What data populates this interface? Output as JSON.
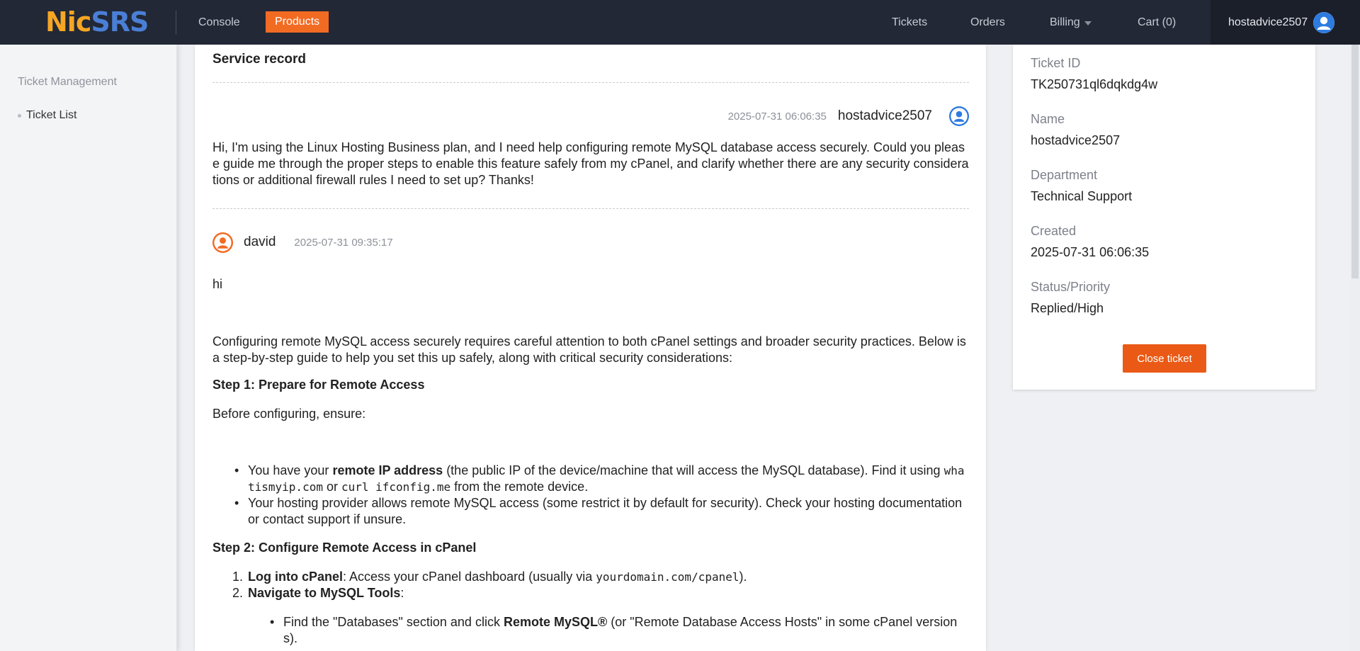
{
  "header": {
    "logo_nic": "Nic",
    "logo_srs": "SRS",
    "nav": {
      "console": "Console",
      "products": "Products",
      "tickets": "Tickets",
      "orders": "Orders",
      "billing": "Billing",
      "cart": "Cart (0)",
      "user": "hostadvice2507"
    }
  },
  "sidebar": {
    "title": "Ticket Management",
    "items": [
      {
        "label": "Ticket List"
      }
    ]
  },
  "main": {
    "section_title": "Service record",
    "messages": [
      {
        "author": "hostadvice2507",
        "time": "2025-07-31 06:06:35",
        "body": "Hi, I'm using the Linux Hosting Business plan, and I need help configuring remote MySQL database access securely. Could you please guide me through the proper steps to enable this feature safely from my cPanel, and clarify whether there are any security considerations or additional firewall rules I need to set up? Thanks!"
      },
      {
        "author": "david",
        "time": "2025-07-31 09:35:17",
        "greeting": "hi",
        "intro": "Configuring remote MySQL access securely requires careful attention to both cPanel settings and broader security practices. Below is a step-by-step guide to help you set this up safely, along with critical security considerations:",
        "step1_title": "Step 1: Prepare for Remote Access",
        "step1_lead": "Before configuring, ensure:",
        "step1_items": [
          {
            "pre": "You have your ",
            "bold": "remote IP address",
            "post1": " (the public IP of the device/machine that will access the MySQL database). Find it using ",
            "code1": "whatismyip.com",
            "mid": " or ",
            "code2": "curl ifconfig.me",
            "post2": " from the remote device."
          },
          {
            "text": "Your hosting provider allows remote MySQL access (some restrict it by default for security). Check your hosting documentation or contact support if unsure."
          }
        ],
        "step2_title": "Step 2: Configure Remote Access in cPanel",
        "step2_items": [
          {
            "num": "1.",
            "bold": "Log into cPanel",
            "post": ": Access your cPanel dashboard (usually via ",
            "code": "yourdomain.com/cpanel",
            "end": ")."
          },
          {
            "num": "2.",
            "bold": "Navigate to MySQL Tools",
            "post": ":"
          }
        ],
        "step2_sub_items": [
          {
            "pre": "Find the \"Databases\" section and click ",
            "bold": "Remote MySQL®",
            "post": " (or \"Remote Database Access Hosts\" in some cPanel versions)."
          }
        ]
      }
    ]
  },
  "ticket_info": {
    "ticket_id_label": "Ticket ID",
    "ticket_id": "TK250731ql6dqkdg4w",
    "name_label": "Name",
    "name": "hostadvice2507",
    "department_label": "Department",
    "department": "Technical Support",
    "created_label": "Created",
    "created": "2025-07-31 06:06:35",
    "status_label": "Status/Priority",
    "status": "Replied/High",
    "close_button": "Close ticket"
  },
  "colors": {
    "topbar": "#222836",
    "accent": "#f26b22",
    "close_button": "#ea5a16",
    "logo_orange": "#f5a623",
    "logo_blue": "#4a7fd6",
    "user_avatar": "#2e7be0"
  },
  "icons": {
    "user_avatar": "user-icon",
    "staff_avatar": "user-icon",
    "billing_caret": "caret-down-icon"
  }
}
